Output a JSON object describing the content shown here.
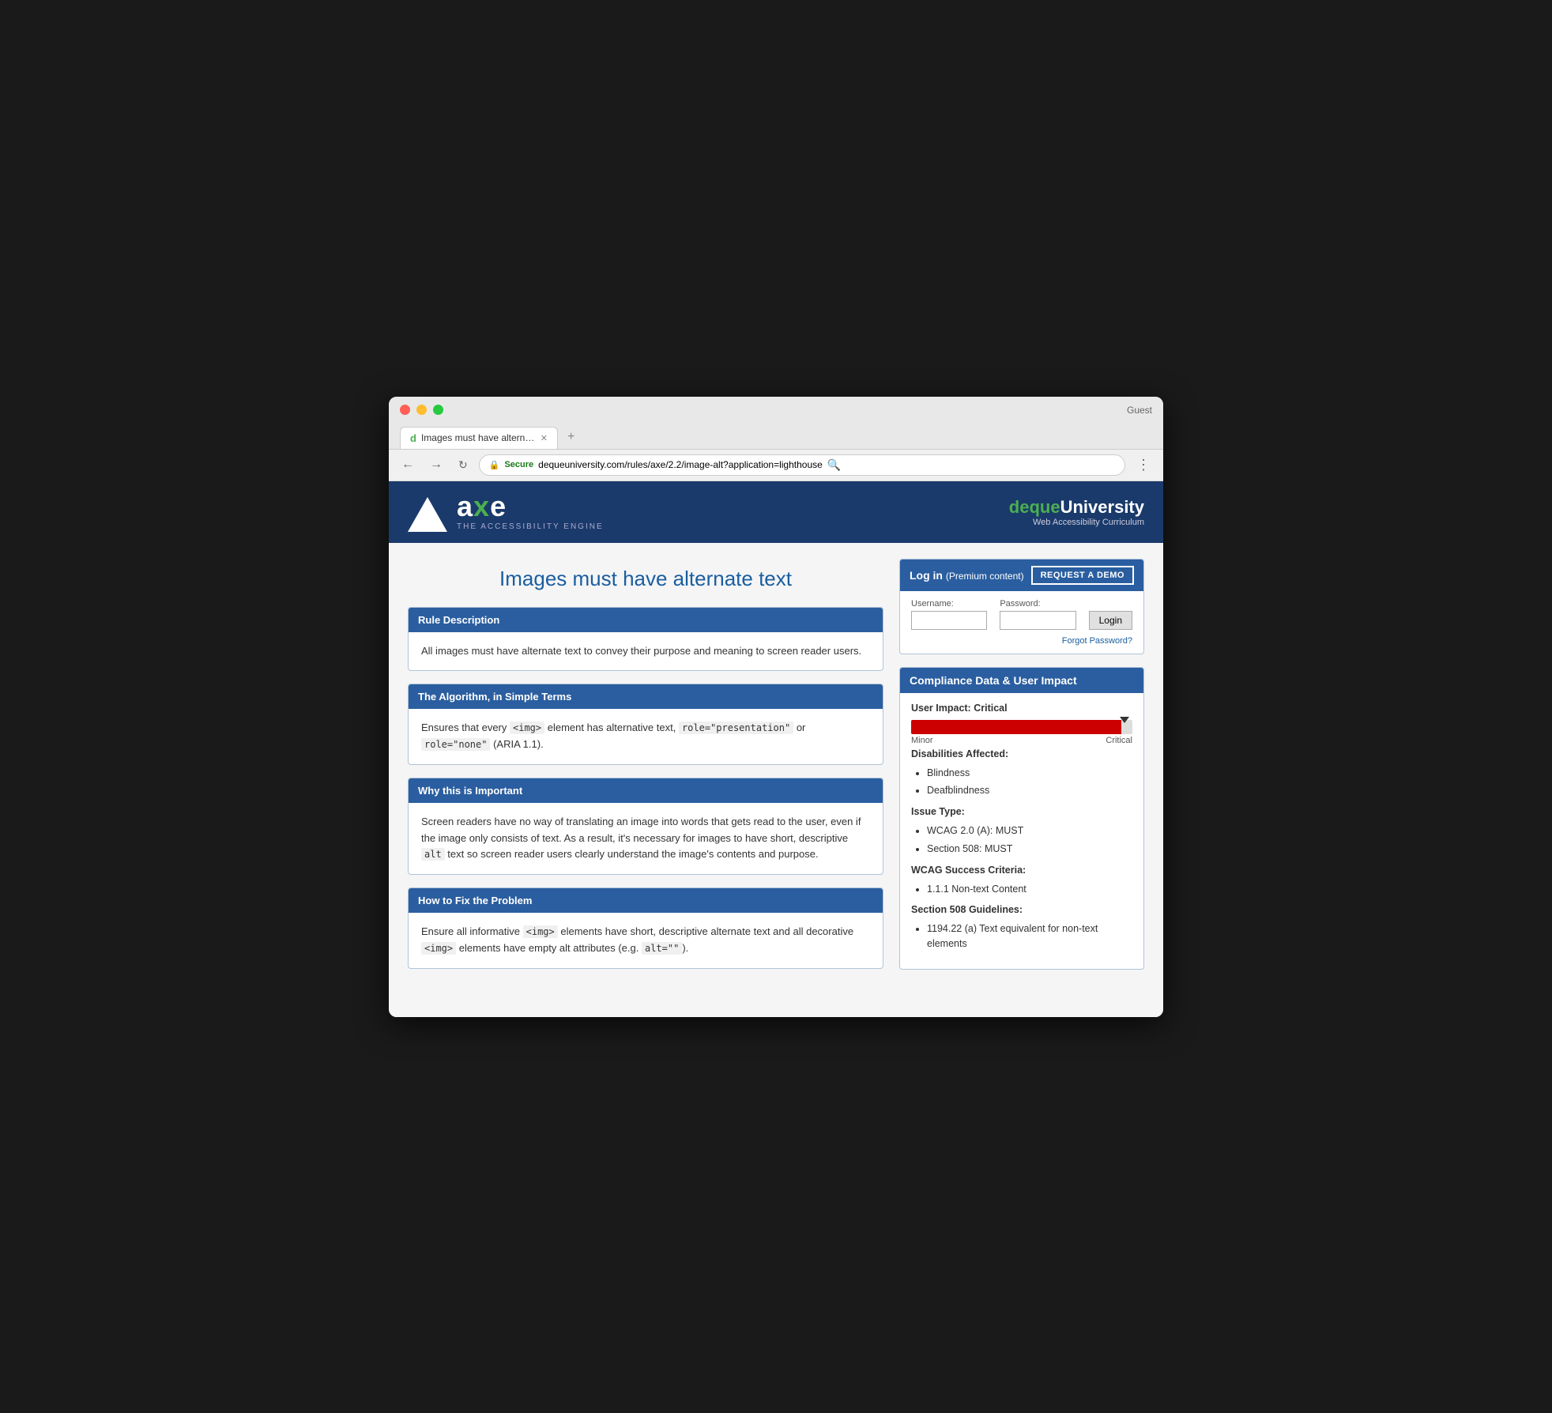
{
  "browser": {
    "guest_label": "Guest",
    "tab_title": "Images must have alternate te…",
    "tab_icon": "d",
    "url_secure": "Secure",
    "url_full": "https://dequeuniversity.com/rules/axe/2.2/image-alt?application=lighthouse",
    "url_domain": "dequeuniversity.com",
    "url_path": "/rules/axe/2.2/image-alt?application=lighthouse"
  },
  "site_header": {
    "logo_name": "axe",
    "logo_highlight": "e",
    "tagline": "THE ACCESSIBILITY ENGINE",
    "brand_name": "deque",
    "brand_highlight": "University",
    "brand_sub": "Web Accessibility Curriculum"
  },
  "page_title": "Images must have alternate text",
  "sections": [
    {
      "id": "rule-description",
      "header": "Rule Description",
      "body": "All images must have alternate text to convey their purpose and meaning to screen reader users."
    },
    {
      "id": "algorithm",
      "header": "The Algorithm, in Simple Terms",
      "body_html": true,
      "body": "Ensures that every <img> element has alternative text, role=\"presentation\" or role=\"none\" (ARIA 1.1)."
    },
    {
      "id": "why-important",
      "header": "Why this is Important",
      "body": "Screen readers have no way of translating an image into words that gets read to the user, even if the image only consists of text. As a result, it's necessary for images to have short, descriptive alt text so screen reader users clearly understand the image's contents and purpose."
    },
    {
      "id": "how-to-fix",
      "header": "How to Fix the Problem",
      "body": "Ensure all informative <img> elements have short, descriptive alternate text and all decorative <img> elements have empty alt attributes (e.g. alt=\"\")."
    }
  ],
  "login": {
    "title": "Log in",
    "subtitle": "(Premium content)",
    "request_demo_label": "REQUEST A DEMO",
    "username_label": "Username:",
    "password_label": "Password:",
    "login_button": "Login",
    "forgot_password": "Forgot Password?"
  },
  "compliance": {
    "panel_title": "Compliance Data & User Impact",
    "user_impact_label": "User Impact:",
    "user_impact_value": "Critical",
    "impact_min": "Minor",
    "impact_max": "Critical",
    "impact_fill_pct": 95,
    "disabilities_label": "Disabilities Affected:",
    "disabilities": [
      "Blindness",
      "Deafblindness"
    ],
    "issue_type_label": "Issue Type:",
    "issue_types": [
      "WCAG 2.0 (A): MUST",
      "Section 508: MUST"
    ],
    "wcag_label": "WCAG Success Criteria:",
    "wcag_items": [
      "1.1.1 Non-text Content"
    ],
    "section508_label": "Section 508 Guidelines:",
    "section508_items": [
      "1194.22 (a) Text equivalent for non-text elements"
    ]
  }
}
